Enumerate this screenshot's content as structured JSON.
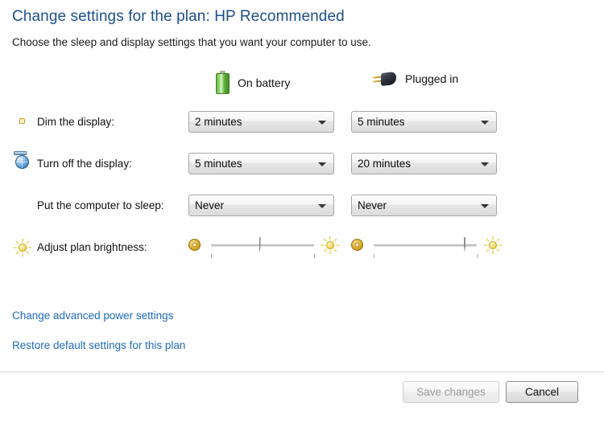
{
  "header": {
    "title": "Change settings for the plan: HP Recommended",
    "subtitle": "Choose the sleep and display settings that you want your computer to use.",
    "title_color": "#1c4f8c"
  },
  "columns": [
    {
      "label": "On battery",
      "icon": "battery-icon"
    },
    {
      "label": "Plugged in",
      "icon": "power-plug-icon"
    }
  ],
  "rows": [
    {
      "label": "Dim the display:",
      "icon": "dim-display-icon",
      "type": "dropdown",
      "battery_value": "2 minutes",
      "plugged_value": "5 minutes"
    },
    {
      "label": "Turn off the display:",
      "icon": "turn-off-display-icon",
      "type": "dropdown",
      "battery_value": "5 minutes",
      "plugged_value": "20 minutes"
    },
    {
      "label": "Put the computer to sleep:",
      "icon": "sleep-icon",
      "type": "dropdown",
      "battery_value": "Never",
      "plugged_value": "Never"
    },
    {
      "label": "Adjust plan brightness:",
      "icon": "brightness-icon",
      "type": "slider",
      "battery_percent": 52,
      "plugged_percent": 93,
      "low_icon": "low-brightness-icon",
      "high_icon": "high-brightness-icon"
    }
  ],
  "links": [
    {
      "label": "Change advanced power settings"
    },
    {
      "label": "Restore default settings for this plan"
    }
  ],
  "footer": {
    "save_label": "Save changes",
    "save_enabled": false,
    "cancel_label": "Cancel",
    "link_color": "#1f6bb8"
  }
}
